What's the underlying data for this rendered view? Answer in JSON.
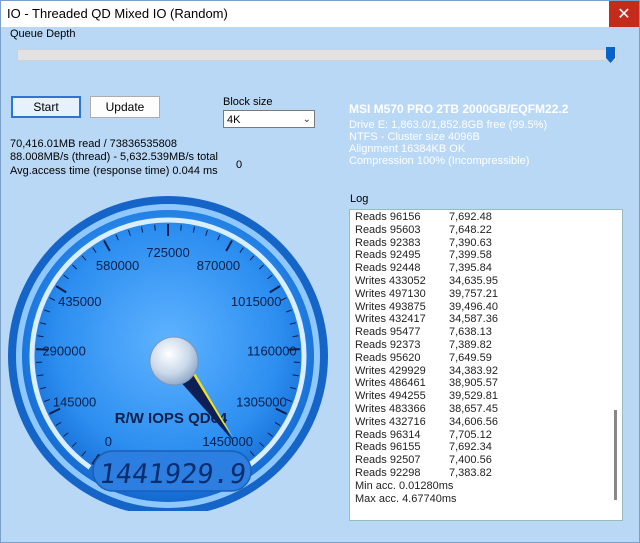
{
  "window": {
    "title": "IO - Threaded QD Mixed IO (Random)",
    "close_glyph": "✕"
  },
  "queue_depth": {
    "label": "Queue Depth"
  },
  "buttons": {
    "start": "Start",
    "update": "Update"
  },
  "block_size": {
    "label": "Block size",
    "value": "4K"
  },
  "stats": {
    "line1": "70,416.01MB read / 73836535808",
    "line2": "88.008MB/s (thread) - 5,632.539MB/s total",
    "line3": "Avg.access time (response time) 0.044 ms",
    "counter": "0"
  },
  "drive": {
    "name": "MSI M570 PRO 2TB 2000GB/EQFM22.2",
    "line1": "Drive E: 1,863.0/1,852.8GB free (99.5%)",
    "line2": "NTFS - Cluster size 4096B",
    "line3": "Alignment 16384KB OK",
    "line4": "Compression 100% (Incompressible)"
  },
  "log": {
    "label": "Log",
    "rows": [
      [
        "Reads 96156",
        "7,692.48"
      ],
      [
        "Reads 95603",
        "7,648.22"
      ],
      [
        "Reads 92383",
        "7,390.63"
      ],
      [
        "Reads 92495",
        "7,399.58"
      ],
      [
        "Reads 92448",
        "7,395.84"
      ],
      [
        "Writes 433052",
        "34,635.95"
      ],
      [
        "Writes 497130",
        "39,757.21"
      ],
      [
        "Writes 493875",
        "39,496.40"
      ],
      [
        "Writes 432417",
        "34,587.36"
      ],
      [
        "Reads 95477",
        "7,638.13"
      ],
      [
        "Reads 92373",
        "7,389.82"
      ],
      [
        "Reads 95620",
        "7,649.59"
      ],
      [
        "Writes 429929",
        "34,383.92"
      ],
      [
        "Writes 486461",
        "38,905.57"
      ],
      [
        "Writes 494255",
        "39,529.81"
      ],
      [
        "Writes 483366",
        "38,657.45"
      ],
      [
        "Writes 432716",
        "34,606.56"
      ],
      [
        "Reads 96314",
        "7,705.12"
      ],
      [
        "Reads 96155",
        "7,692.34"
      ],
      [
        "Reads 92507",
        "7,400.56"
      ],
      [
        "Reads 92298",
        "7,383.82"
      ],
      [
        "Min acc. 0.01280ms",
        ""
      ],
      [
        "Max acc. 4.67740ms",
        ""
      ]
    ]
  },
  "gauge": {
    "title": "R/W IOPS QD64",
    "display": "1441929.9",
    "value": 1441929.9,
    "max": 1450000,
    "ticks": [
      "0",
      "145000",
      "290000",
      "435000",
      "580000",
      "725000",
      "870000",
      "1015000",
      "1160000",
      "1305000",
      "1450000"
    ]
  },
  "colors": {
    "background": "#b9d8f5",
    "close_red": "#c42b1c",
    "gauge_blue": "#1b6fd6",
    "needle": "#0d1f55",
    "needle_highlight": "#f4e21a"
  }
}
